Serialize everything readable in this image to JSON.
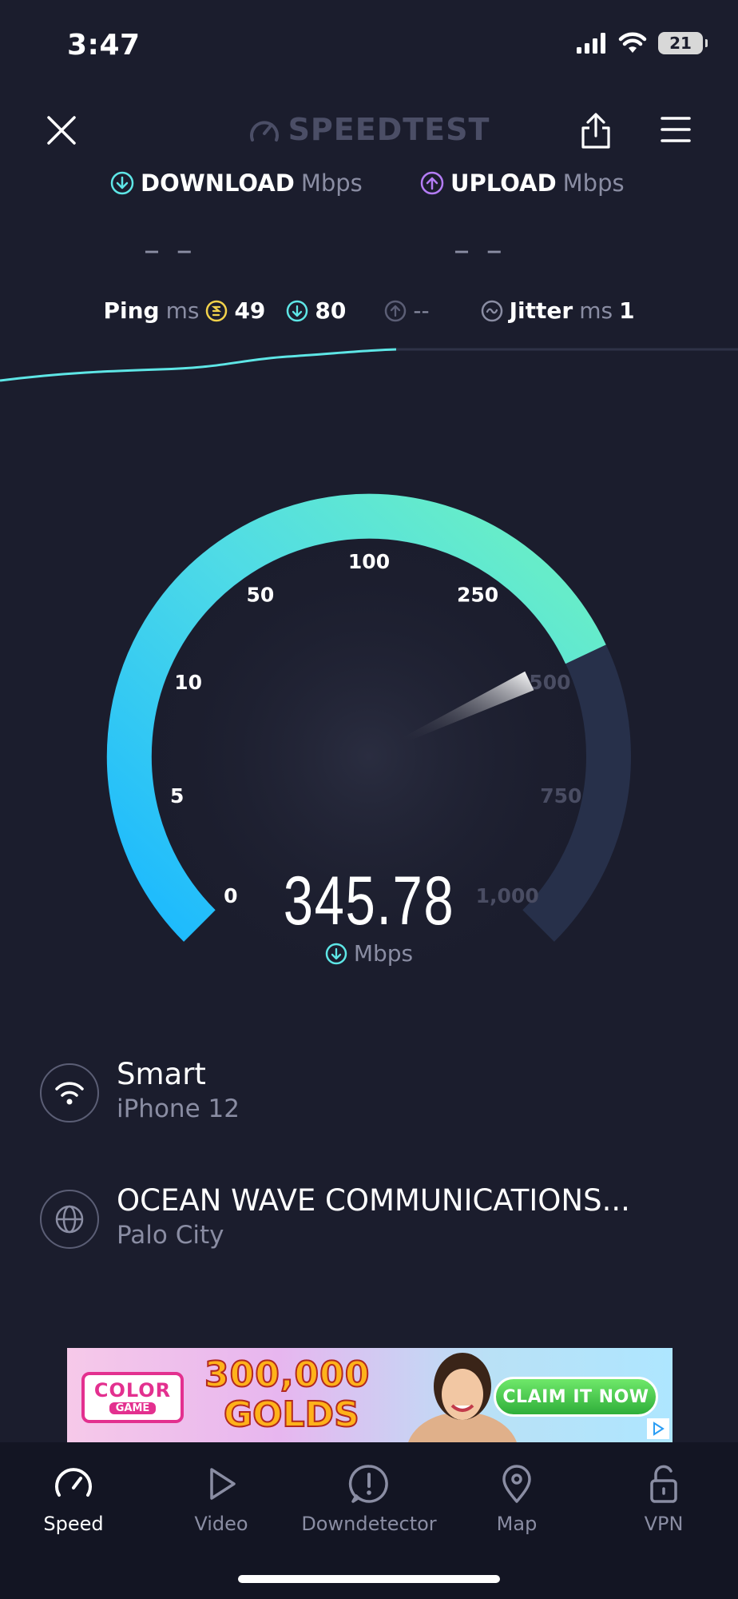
{
  "status_bar": {
    "time": "3:47",
    "battery": "21"
  },
  "header": {
    "brand": "SPEEDTEST"
  },
  "metrics": {
    "download": {
      "label": "DOWNLOAD",
      "unit": "Mbps",
      "value": "– –"
    },
    "upload": {
      "label": "UPLOAD",
      "unit": "Mbps",
      "value": "– –"
    }
  },
  "ping": {
    "label": "Ping",
    "unit": "ms",
    "idle": "49",
    "download": "80",
    "upload": "--",
    "jitter_label": "Jitter",
    "jitter_unit": "ms",
    "jitter": "1"
  },
  "gauge": {
    "ticks": [
      "0",
      "5",
      "10",
      "50",
      "100",
      "250",
      "500",
      "750",
      "1,000"
    ],
    "value": "345.78",
    "unit": "Mbps",
    "level_fraction": 0.74
  },
  "network": {
    "wifi_name": "Smart",
    "device": "iPhone 12",
    "isp": "OCEAN WAVE COMMUNICATIONS...",
    "location": "Palo City"
  },
  "ad": {
    "brand_top": "COLOR",
    "brand_bottom": "GAME",
    "amount": "300,000",
    "currency": "GOLDS",
    "cta": "CLAIM IT NOW"
  },
  "tabs": [
    {
      "label": "Speed",
      "icon": "speedometer-icon",
      "active": true
    },
    {
      "label": "Video",
      "icon": "play-icon",
      "active": false
    },
    {
      "label": "Downdetector",
      "icon": "alert-icon",
      "active": false
    },
    {
      "label": "Map",
      "icon": "map-pin-icon",
      "active": false
    },
    {
      "label": "VPN",
      "icon": "lock-open-icon",
      "active": false
    }
  ],
  "colors": {
    "background": "#1b1d2d",
    "accent_cyan": "#5ee6e6",
    "accent_purple": "#b47cf5",
    "ping_yellow": "#f2d24b",
    "gauge_start": "#1ab8ff",
    "gauge_end": "#6ef2c0"
  }
}
